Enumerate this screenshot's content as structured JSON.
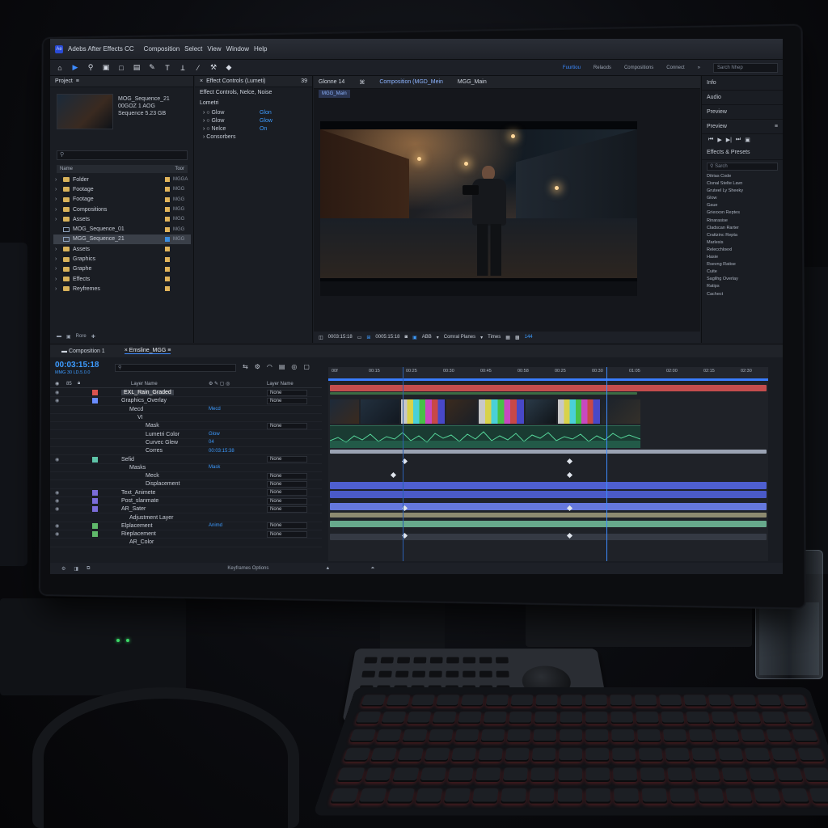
{
  "app": {
    "badge": "Ae",
    "title": "Adebs After Effects CC",
    "menu": [
      "Composition",
      "Select",
      "View",
      "Window",
      "Help"
    ]
  },
  "workspaces": {
    "items": [
      "Fuurtiou",
      "Relaods",
      "Compositions",
      "Connect"
    ],
    "active_index": 0,
    "search_placeholder": "Sarch Nhep"
  },
  "project": {
    "title": "Project",
    "thumb_name": "MOG_Sequence_21",
    "thumb_size": "00GOZ 1 AOG",
    "thumb_seq": "Sequence 5.23 GB",
    "search_placeholder": "",
    "col_name": "Name",
    "col_type": "Toor",
    "items": [
      {
        "name": "Folder",
        "kind": "folder",
        "type": "MGGA"
      },
      {
        "name": "Footage",
        "kind": "folder",
        "type": "MGG"
      },
      {
        "name": "Footage",
        "kind": "folder",
        "type": "MGG"
      },
      {
        "name": "Compositions",
        "kind": "folder",
        "type": "MGG"
      },
      {
        "name": "Assets",
        "kind": "folder",
        "type": "MGG"
      },
      {
        "name": "MOG_Sequence_01",
        "kind": "file",
        "type": "MGG"
      },
      {
        "name": "MGG_Sequence_21",
        "kind": "file",
        "type": "MGG"
      },
      {
        "name": "Assets",
        "kind": "folder",
        "type": ""
      },
      {
        "name": "Graphics",
        "kind": "folder",
        "type": ""
      },
      {
        "name": "Graphe",
        "kind": "folder",
        "type": ""
      },
      {
        "name": "Effects",
        "kind": "folder",
        "type": ""
      },
      {
        "name": "Reyfremes",
        "kind": "folder",
        "type": ""
      }
    ],
    "footer": "Rore"
  },
  "effect_controls": {
    "title": "Effect Controls (Lumeti)",
    "count": "39",
    "subtitle": "Effect Controls, Nelce, Noise",
    "group": "Lometri",
    "rows": [
      {
        "name": "Glow",
        "value": "Glon"
      },
      {
        "name": "Glow",
        "value": "Glow"
      },
      {
        "name": "Nelce",
        "value": "On"
      },
      {
        "name": "Consorbers",
        "value": ""
      }
    ]
  },
  "composition": {
    "tab_label": "Glonne",
    "tab_count": "14",
    "panel_title": "Composition (MGD_Mein",
    "secondary": "MGG_Main",
    "breadcrumb": "MGG_Main",
    "timecode_a": "0003:15:18",
    "timecode_b": "0005:15:18",
    "zoom": "ABB",
    "view_label": "Comral Planes",
    "render_label": "Times",
    "quality": "144"
  },
  "right_panel": {
    "items": [
      "Info",
      "Audio",
      "Preview"
    ],
    "preview_label": "Preview",
    "effects_title": "Effects & Presets",
    "effects_search": "Sarch",
    "effects_list": [
      "Ditrias Code",
      "Cisnal Stelte Lavn",
      "Gruteel Ly Sheeky",
      "Glow",
      "Gaue",
      "Griexxon Reptes",
      "Rinarasise",
      "Cladscan Rarter",
      "Crattzinc Repta",
      "Marlesis",
      "Relecchloexl",
      "Hasie",
      "Rsevng Ratise",
      "Cuite",
      "Saglihg Overlay",
      "Ratips",
      "Cachect"
    ]
  },
  "timeline": {
    "tab_comp": "Composition 1",
    "tab_timeline": "Emsline_MGG",
    "timecode": "00:03:15:18",
    "fps": "MMG 30 LD.5.0.0",
    "col_layer_name": "Layer Name",
    "col_mode": "Layer Name",
    "col_num": "85",
    "ruler": [
      "00f",
      "00:15",
      "00:25",
      "00:30",
      "00:45",
      "00:58",
      "00:25",
      "00:30",
      "01:05",
      "02:00",
      "02:15",
      "02:30"
    ],
    "footer": "Keyframes Options",
    "layers": [
      {
        "label": "EXL_Rain_Graded",
        "color": "#d9534f",
        "selected": true,
        "mode": "None",
        "indent": 0
      },
      {
        "label": "Graphics_Overlay",
        "color": "#6a8cff",
        "selected": false,
        "mode": "None",
        "indent": 0
      },
      {
        "label": "Mecd",
        "color": "",
        "selected": false,
        "mode": "",
        "value": "Mecd",
        "indent": 1
      },
      {
        "label": "VI",
        "color": "",
        "selected": false,
        "mode": "",
        "indent": 2
      },
      {
        "label": "Mask",
        "color": "",
        "selected": false,
        "mode": "None",
        "indent": 3
      },
      {
        "label": "Lumetri Color",
        "color": "",
        "selected": false,
        "mode": "",
        "value": "Glow",
        "indent": 3
      },
      {
        "label": "Curvec Glew",
        "color": "",
        "selected": false,
        "mode": "",
        "value": "04",
        "indent": 3
      },
      {
        "label": "Corres",
        "color": "",
        "selected": false,
        "mode": "",
        "value": "00:03:15:38",
        "indent": 3
      },
      {
        "label": "Sefid",
        "color": "#5ec4a8",
        "selected": false,
        "mode": "None",
        "indent": 0
      },
      {
        "label": "Masks",
        "color": "",
        "selected": false,
        "mode": "",
        "value": "Mask",
        "indent": 1
      },
      {
        "label": "Meck",
        "color": "",
        "selected": false,
        "mode": "None",
        "indent": 3
      },
      {
        "label": "Displacement",
        "color": "",
        "selected": false,
        "mode": "None",
        "indent": 3
      },
      {
        "label": "Text_Animete",
        "color": "#7b6cd9",
        "selected": false,
        "mode": "None",
        "indent": 0
      },
      {
        "label": "Post_slanmate",
        "color": "#7b6cd9",
        "selected": false,
        "mode": "None",
        "indent": 0
      },
      {
        "label": "AR_Sater",
        "color": "#7b6cd9",
        "selected": false,
        "mode": "None",
        "indent": 0
      },
      {
        "label": "Adjustment Layer",
        "color": "",
        "selected": false,
        "mode": "",
        "indent": 1
      },
      {
        "label": "Elplacement",
        "color": "#5fb86a",
        "selected": false,
        "mode": "None",
        "indent": 0,
        "value": "Animd"
      },
      {
        "label": "Rieplacement",
        "color": "#5fb86a",
        "selected": false,
        "mode": "None",
        "indent": 0
      },
      {
        "label": "AR_Color",
        "color": "",
        "selected": false,
        "mode": "",
        "indent": 1
      }
    ]
  }
}
